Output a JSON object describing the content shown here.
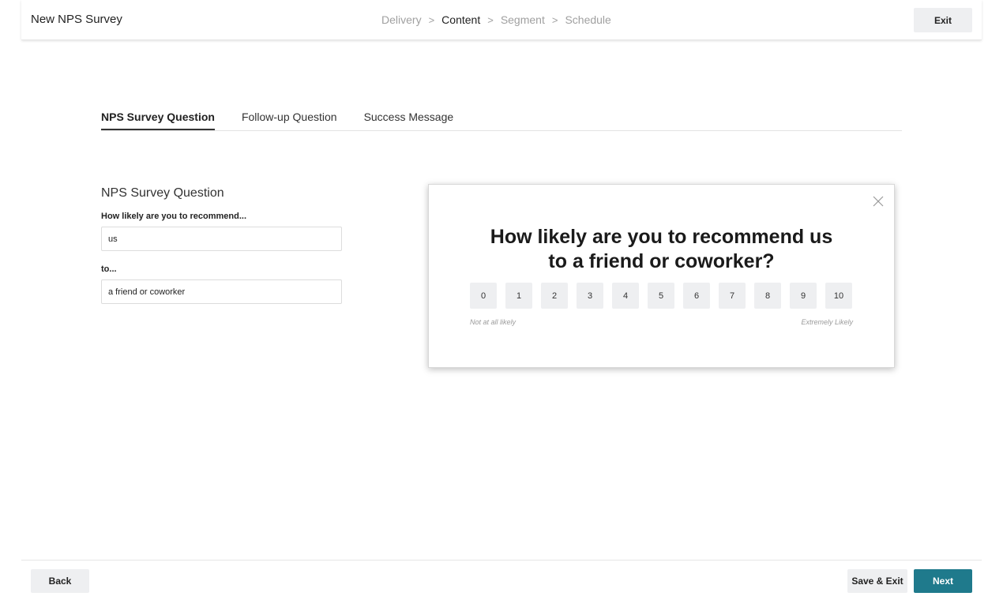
{
  "header": {
    "title": "New NPS Survey",
    "steps": [
      {
        "label": "Delivery"
      },
      {
        "label": "Content"
      },
      {
        "label": "Segment"
      },
      {
        "label": "Schedule"
      }
    ],
    "active_step": "Content",
    "exit_label": "Exit"
  },
  "tabs": [
    {
      "label": "NPS Survey Question"
    },
    {
      "label": "Follow-up Question"
    },
    {
      "label": "Success Message"
    }
  ],
  "form": {
    "title": "NPS Survey Question",
    "recommend_label": "How likely are you to recommend...",
    "recommend_value": "us",
    "to_label": "to...",
    "to_value": "a friend or coworker"
  },
  "preview": {
    "question_line1": "How likely are you to recommend us",
    "question_line2": "to a friend or coworker?",
    "scores": [
      "0",
      "1",
      "2",
      "3",
      "4",
      "5",
      "6",
      "7",
      "8",
      "9",
      "10"
    ],
    "low_label": "Not at all likely",
    "high_label": "Extremely Likely",
    "close_icon": "close-icon"
  },
  "footer": {
    "back_label": "Back",
    "save_exit_label": "Save & Exit",
    "next_label": "Next"
  },
  "colors": {
    "accent": "#1f7a8c",
    "button_gray": "#eeeff1"
  }
}
